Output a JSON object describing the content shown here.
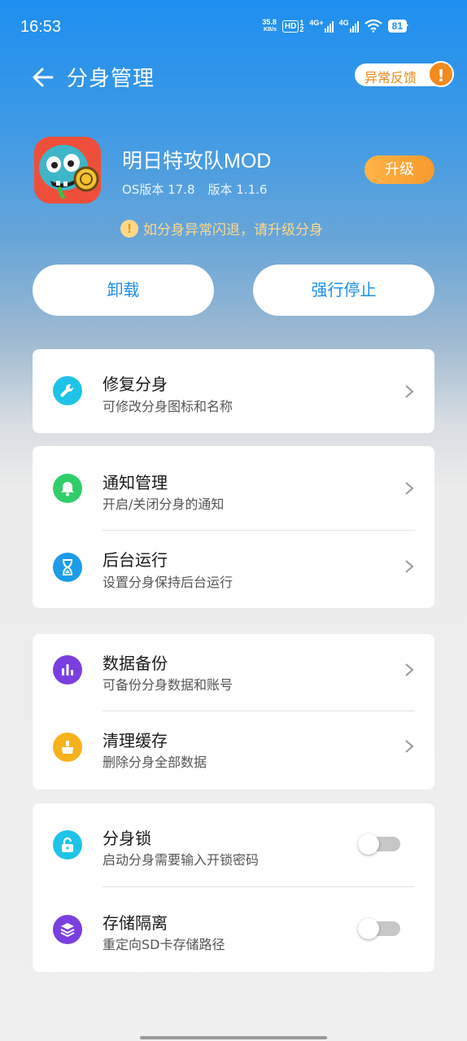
{
  "status_bar": {
    "time": "16:53",
    "net_speed_value": "35.8",
    "net_speed_unit": "KB/s",
    "hd_label": "HD",
    "sim1_label": "1",
    "sim2_label": "2",
    "network1": "4G+",
    "network2": "4G",
    "battery": "81"
  },
  "header": {
    "title": "分身管理",
    "feedback_label": "异常反馈",
    "feedback_alert": "!"
  },
  "app": {
    "name": "明日特攻队MOD",
    "os_version": "OS版本 17.8",
    "version": "版本 1.1.6",
    "upgrade_label": "升级",
    "warning_text": "如分身异常闪退，请升级分身"
  },
  "actions": {
    "uninstall_label": "卸载",
    "force_stop_label": "强行停止"
  },
  "cards": [
    {
      "rows": [
        {
          "title": "修复分身",
          "subtitle": "可修改分身图标和名称",
          "icon": "wrench-icon",
          "icon_color": "#1fc3e8",
          "control": "chevron"
        }
      ]
    },
    {
      "rows": [
        {
          "title": "通知管理",
          "subtitle": "开启/关闭分身的通知",
          "icon": "bell-icon",
          "icon_color": "#2fce6a",
          "control": "chevron"
        },
        {
          "title": "后台运行",
          "subtitle": "设置分身保持后台运行",
          "icon": "hourglass-icon",
          "icon_color": "#1c9ce8",
          "control": "chevron"
        }
      ]
    },
    {
      "rows": [
        {
          "title": "数据备份",
          "subtitle": "可备份分身数据和账号",
          "icon": "bar-chart-icon",
          "icon_color": "#7a3fe0",
          "control": "chevron"
        },
        {
          "title": "清理缓存",
          "subtitle": "删除分身全部数据",
          "icon": "broom-icon",
          "icon_color": "#f7b21c",
          "control": "chevron"
        }
      ]
    },
    {
      "rows": [
        {
          "title": "分身锁",
          "subtitle": "启动分身需要输入开锁密码",
          "icon": "lock-icon",
          "icon_color": "#1fc3e8",
          "control": "toggle",
          "toggle_on": false
        },
        {
          "title": "存储隔离",
          "subtitle": "重定向SD卡存储路径",
          "icon": "layers-icon",
          "icon_color": "#7a3fe0",
          "control": "toggle",
          "toggle_on": false
        }
      ]
    }
  ],
  "colors": {
    "accent": "#1c8fe8",
    "warning": "#f79a2e"
  }
}
